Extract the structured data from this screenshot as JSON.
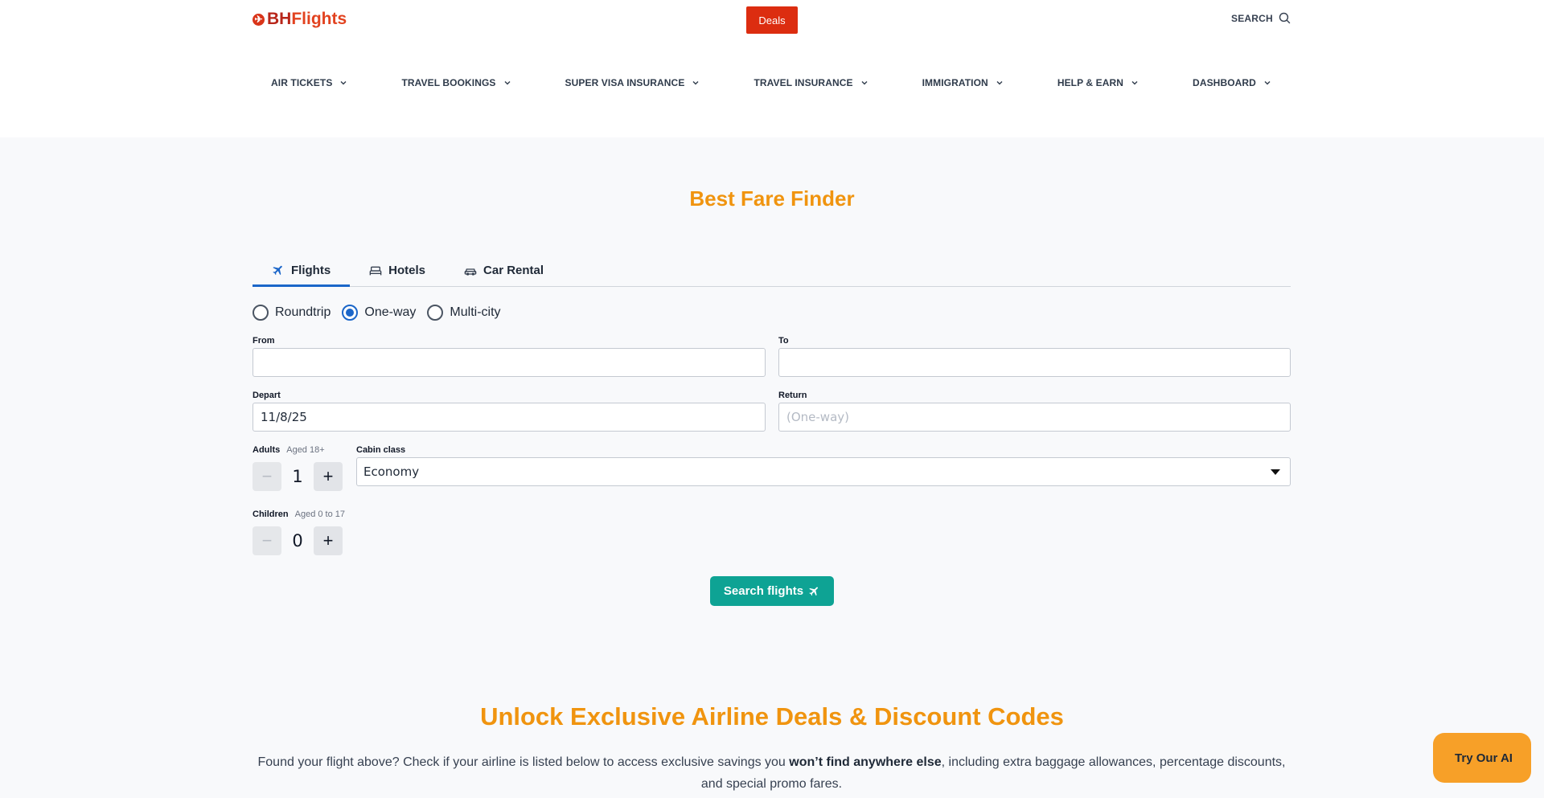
{
  "header": {
    "logo_prefix": "BH",
    "logo_suffix": "Flights",
    "deals_label": "Deals",
    "search_label": "SEARCH"
  },
  "nav": {
    "items": [
      {
        "label": "AIR TICKETS"
      },
      {
        "label": "TRAVEL BOOKINGS"
      },
      {
        "label": "SUPER VISA INSURANCE"
      },
      {
        "label": "TRAVEL INSURANCE"
      },
      {
        "label": "IMMIGRATION"
      },
      {
        "label": "HELP & EARN"
      },
      {
        "label": "DASHBOARD"
      }
    ]
  },
  "finder": {
    "title": "Best Fare Finder",
    "tabs": [
      {
        "label": "Flights",
        "icon": "plane-icon",
        "active": true
      },
      {
        "label": "Hotels",
        "icon": "bed-icon",
        "active": false
      },
      {
        "label": "Car Rental",
        "icon": "car-icon",
        "active": false
      }
    ],
    "trip_types": [
      {
        "label": "Roundtrip",
        "checked": false
      },
      {
        "label": "One-way",
        "checked": true
      },
      {
        "label": "Multi-city",
        "checked": false
      }
    ],
    "from": {
      "label": "From",
      "value": ""
    },
    "to": {
      "label": "To",
      "value": ""
    },
    "depart": {
      "label": "Depart",
      "value": "11/8/25"
    },
    "return": {
      "label": "Return",
      "placeholder": "(One-way)"
    },
    "adults": {
      "label": "Adults",
      "hint": "Aged 18+",
      "value": "1"
    },
    "children": {
      "label": "Children",
      "hint": "Aged 0 to 17",
      "value": "0"
    },
    "cabin": {
      "label": "Cabin class",
      "value": "Economy"
    },
    "search_button": "Search flights"
  },
  "deals": {
    "title": "Unlock Exclusive Airline Deals & Discount Codes",
    "text_before": "Found your flight above? Check if your airline is listed below to access exclusive savings you ",
    "text_bold": "won’t find anywhere else",
    "text_after": ", including extra baggage allowances, percentage discounts, and special promo fares."
  },
  "ai_button": {
    "icon_glyph": "",
    "label": "Try Our AI"
  },
  "colors": {
    "brand_red": "#dc2d10",
    "accent_orange": "#f0940f",
    "accent_blue": "#1b66c9",
    "teal": "#0ea394"
  }
}
